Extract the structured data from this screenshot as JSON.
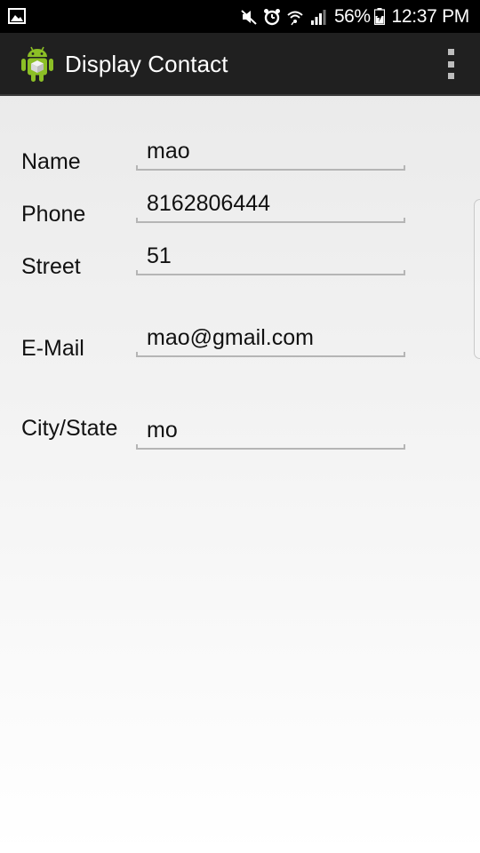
{
  "status_bar": {
    "battery_percent": "56%",
    "time": "12:37 PM",
    "icons": [
      "gallery-icon",
      "mute-icon",
      "alarm-icon",
      "wifi-icon",
      "signal-icon",
      "battery-icon"
    ]
  },
  "action_bar": {
    "title": "Display Contact",
    "logo_icon": "android-logo-icon",
    "menu_icon": "overflow-menu-icon"
  },
  "form": {
    "fields": [
      {
        "label": "Name",
        "value": "mao"
      },
      {
        "label": "Phone",
        "value": "8162806444"
      },
      {
        "label": "Street",
        "value": "51"
      },
      {
        "label": "E-Mail",
        "value": "mao@gmail.com"
      },
      {
        "label": "City/State",
        "value": "mo"
      }
    ]
  },
  "colors": {
    "status_bar_bg": "#000000",
    "action_bar_bg": "#202020",
    "underline": "#b5b5b5",
    "android_green": "#8cbf26"
  }
}
